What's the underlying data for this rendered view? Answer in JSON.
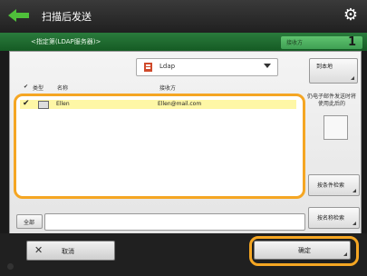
{
  "header": {
    "title": "扫描后发送",
    "subtitle": "<指定第(LDAP服务器)>",
    "dest_label": "接收方",
    "dest_count": "1"
  },
  "source": {
    "selected": "Ldap"
  },
  "buttons": {
    "to_local": "到本地",
    "by_condition": "按条件检索",
    "by_name": "按名称检索",
    "all": "全部",
    "cancel": "取消",
    "ok": "确定"
  },
  "list": {
    "headers": {
      "check": "✔",
      "type": "类型",
      "name": "名称",
      "address": "接收方"
    },
    "rows": [
      {
        "checked": "✔",
        "name": "Ellen",
        "address": "Ellen@mail.com"
      }
    ]
  },
  "side_note": "仍电子邮件发送时将使用此后的",
  "filter": {
    "value": ""
  },
  "colors": {
    "accent": "#f5a623",
    "green": "#2a7b3c"
  },
  "icons": [
    "back-arrow-icon",
    "gear-icon",
    "ldap-server-icon",
    "address-book-icon",
    "close-icon"
  ]
}
